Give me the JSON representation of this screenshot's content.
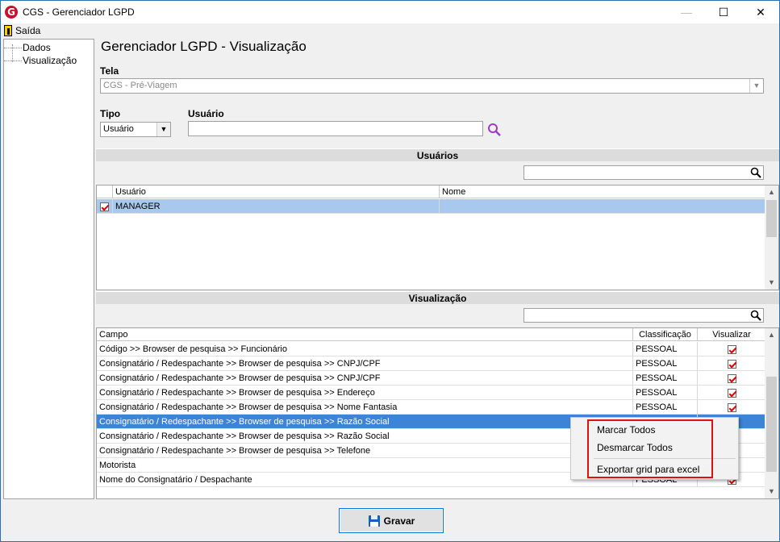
{
  "window": {
    "title": "CGS - Gerenciador LGPD",
    "app_icon_glyph": "G",
    "controls": {
      "minimize": "—",
      "maximize": "☐",
      "close": "✕"
    }
  },
  "menu": {
    "exit_label": "Saída"
  },
  "tree": {
    "items": [
      {
        "label": "Dados"
      },
      {
        "label": "Visualização"
      }
    ]
  },
  "page": {
    "title": "Gerenciador LGPD - Visualização"
  },
  "tela": {
    "label": "Tela",
    "value": "CGS - Pré-Viagem"
  },
  "tipo": {
    "label": "Tipo",
    "value": "Usuário"
  },
  "usuario_field": {
    "label": "Usuário",
    "value": ""
  },
  "usuarios_section": {
    "header": "Usuários",
    "filter_value": "",
    "columns": [
      "Usuário",
      "Nome"
    ],
    "rows": [
      {
        "checked": true,
        "usuario": "MANAGER",
        "nome": ""
      }
    ]
  },
  "visualizacao_section": {
    "header": "Visualização",
    "filter_value": "",
    "columns": [
      "Campo",
      "Classificação",
      "Visualizar"
    ],
    "rows": [
      {
        "campo": "Código >> Browser de pesquisa >> Funcionário",
        "classificacao": "PESSOAL",
        "visualizar": true
      },
      {
        "campo": "Consignatário / Redespachante >> Browser de pesquisa >> CNPJ/CPF",
        "classificacao": "PESSOAL",
        "visualizar": true
      },
      {
        "campo": "Consignatário / Redespachante >> Browser de pesquisa >> CNPJ/CPF",
        "classificacao": "PESSOAL",
        "visualizar": true
      },
      {
        "campo": "Consignatário / Redespachante >> Browser de pesquisa >> Endereço",
        "classificacao": "PESSOAL",
        "visualizar": true
      },
      {
        "campo": "Consignatário / Redespachante >> Browser de pesquisa >> Nome Fantasia",
        "classificacao": "PESSOAL",
        "visualizar": true
      },
      {
        "campo": "Consignatário / Redespachante >> Browser de pesquisa >> Razão Social",
        "classificacao": "",
        "visualizar": true,
        "selected": true
      },
      {
        "campo": "Consignatário / Redespachante >> Browser de pesquisa >> Razão Social",
        "classificacao": "",
        "visualizar": null
      },
      {
        "campo": "Consignatário / Redespachante >> Browser de pesquisa >> Telefone",
        "classificacao": "",
        "visualizar": null
      },
      {
        "campo": "Motorista",
        "classificacao": "",
        "visualizar": null
      },
      {
        "campo": "Nome do Consignatário / Despachante",
        "classificacao": "PESSOAL",
        "visualizar": true
      }
    ]
  },
  "context_menu": {
    "items": [
      "Marcar Todos",
      "Desmarcar Todos",
      "Exportar grid para excel"
    ]
  },
  "footer": {
    "save_label": "Gravar"
  },
  "colors": {
    "selection": "#3d83d6",
    "highlight_border": "#e01010",
    "search_icon_purple": "#9b3cc6"
  }
}
